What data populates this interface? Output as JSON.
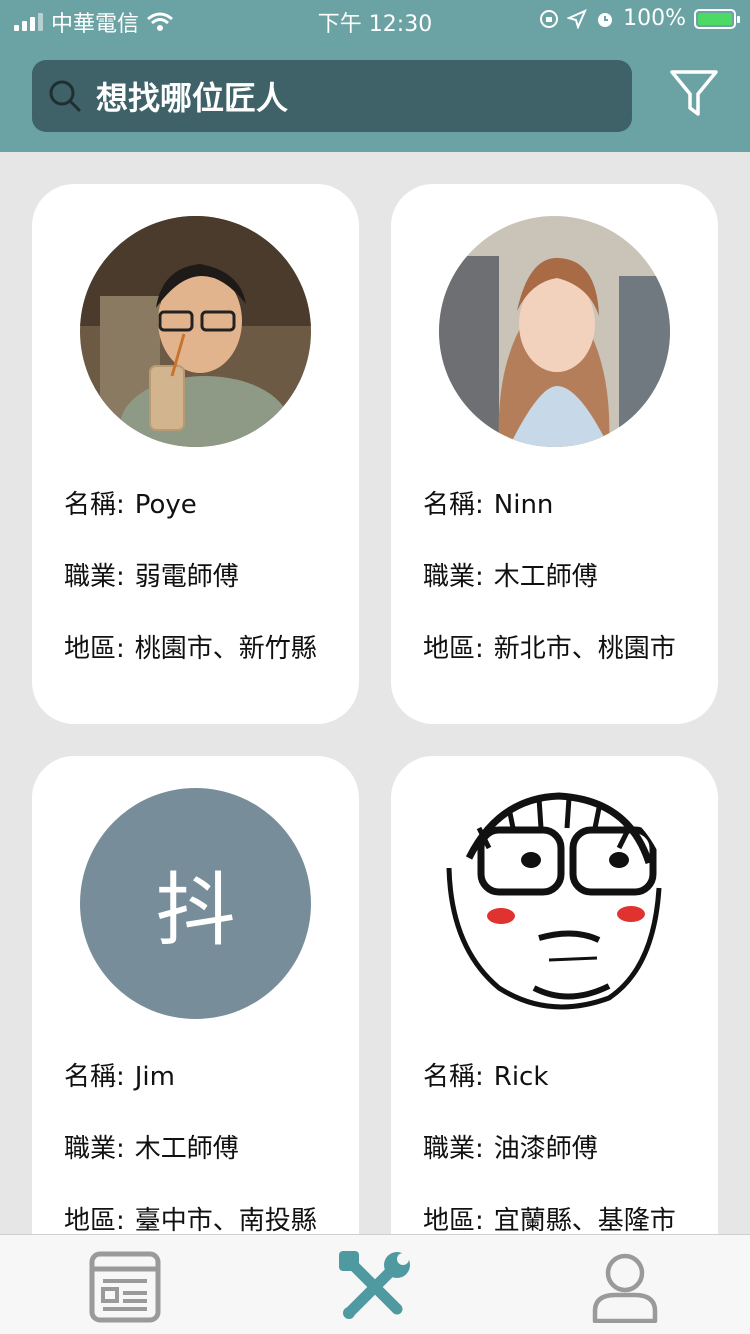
{
  "status_bar": {
    "carrier": "中華電信",
    "time": "下午 12:30",
    "battery": "100%"
  },
  "search": {
    "placeholder": "想找哪位匠人",
    "icon": "search-icon"
  },
  "filter": {
    "icon": "filter-icon"
  },
  "cards": [
    {
      "name_label": "名稱:",
      "name": "Poye",
      "job_label": "職業:",
      "job": "弱電師傅",
      "area_label": "地區:",
      "area": "桃園市、新竹縣",
      "avatar": "photo"
    },
    {
      "name_label": "名稱:",
      "name": "Ninn",
      "job_label": "職業:",
      "job": "木工師傅",
      "area_label": "地區:",
      "area": "新北市、桃園市",
      "avatar": "photo"
    },
    {
      "name_label": "名稱:",
      "name": "Jim",
      "job_label": "職業:",
      "job": "木工師傅",
      "area_label": "地區:",
      "area": "臺中市、南投縣",
      "avatar_text": "抖",
      "avatar": "text"
    },
    {
      "name_label": "名稱:",
      "name": "Rick",
      "job_label": "職業:",
      "job": "油漆師傅",
      "area_label": "地區:",
      "area": "宜蘭縣、基隆市",
      "avatar": "drawing"
    }
  ],
  "tabs": [
    {
      "icon": "article-icon",
      "active": false
    },
    {
      "icon": "tools-icon",
      "active": true
    },
    {
      "icon": "user-icon",
      "active": false
    }
  ],
  "colors": {
    "header": "#6ba3a5",
    "search_bg": "#3f6268",
    "active_tab": "#4f9aa0",
    "inactive_tab": "#9a9a9a"
  }
}
